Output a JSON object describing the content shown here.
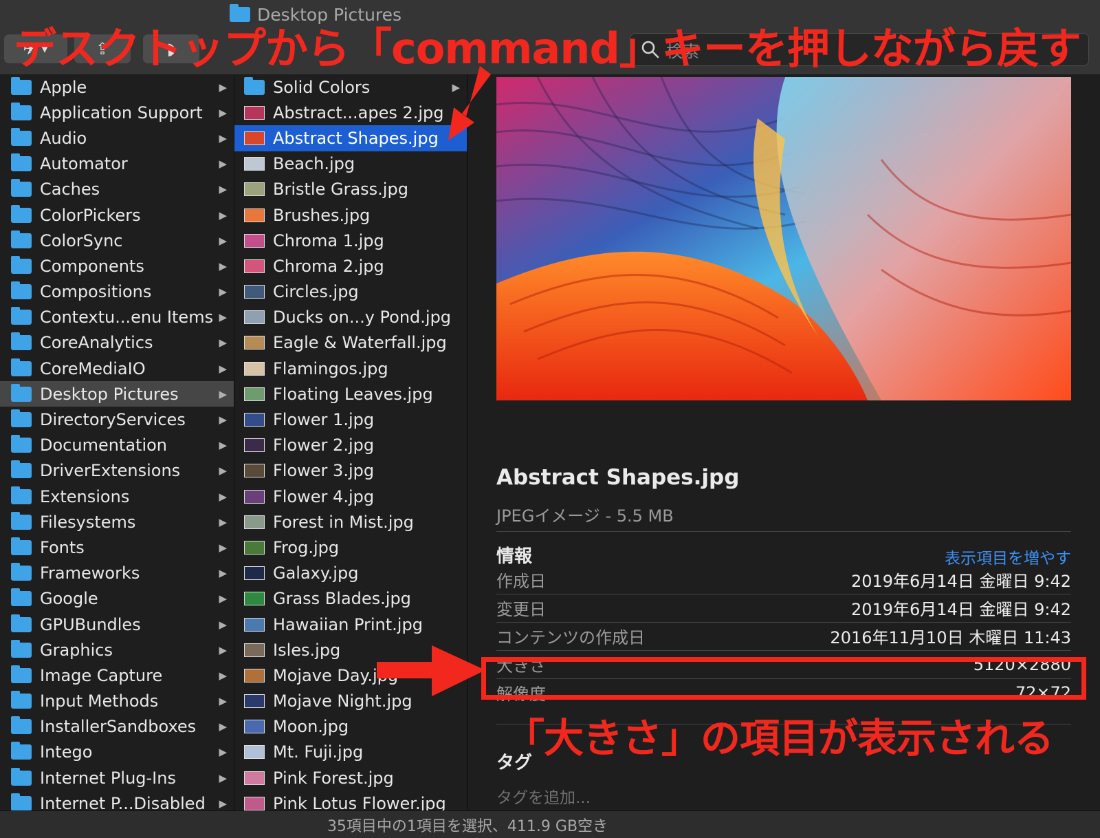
{
  "window": {
    "title": "Desktop Pictures"
  },
  "toolbar": {
    "back_forward_glyph": "✈︎",
    "share_glyph": "⇪",
    "tag_glyph": "◗",
    "search_placeholder": "検索"
  },
  "column1": {
    "items": [
      {
        "label": "Apple"
      },
      {
        "label": "Application Support"
      },
      {
        "label": "Audio"
      },
      {
        "label": "Automator"
      },
      {
        "label": "Caches"
      },
      {
        "label": "ColorPickers"
      },
      {
        "label": "ColorSync"
      },
      {
        "label": "Components"
      },
      {
        "label": "Compositions"
      },
      {
        "label": "Contextu...enu Items"
      },
      {
        "label": "CoreAnalytics"
      },
      {
        "label": "CoreMediaIO"
      },
      {
        "label": "Desktop Pictures"
      },
      {
        "label": "DirectoryServices"
      },
      {
        "label": "Documentation"
      },
      {
        "label": "DriverExtensions"
      },
      {
        "label": "Extensions"
      },
      {
        "label": "Filesystems"
      },
      {
        "label": "Fonts"
      },
      {
        "label": "Frameworks"
      },
      {
        "label": "Google"
      },
      {
        "label": "GPUBundles"
      },
      {
        "label": "Graphics"
      },
      {
        "label": "Image Capture"
      },
      {
        "label": "Input Methods"
      },
      {
        "label": "InstallerSandboxes"
      },
      {
        "label": "Intego"
      },
      {
        "label": "Internet Plug-Ins"
      },
      {
        "label": "Internet P...Disabled"
      }
    ]
  },
  "column2": {
    "items": [
      {
        "label": "Solid Colors"
      },
      {
        "label": "Abstract...apes 2.jpg"
      },
      {
        "label": "Abstract Shapes.jpg"
      },
      {
        "label": "Beach.jpg"
      },
      {
        "label": "Bristle Grass.jpg"
      },
      {
        "label": "Brushes.jpg"
      },
      {
        "label": "Chroma 1.jpg"
      },
      {
        "label": "Chroma 2.jpg"
      },
      {
        "label": "Circles.jpg"
      },
      {
        "label": "Ducks on...y Pond.jpg"
      },
      {
        "label": "Eagle & Waterfall.jpg"
      },
      {
        "label": "Flamingos.jpg"
      },
      {
        "label": "Floating Leaves.jpg"
      },
      {
        "label": "Flower 1.jpg"
      },
      {
        "label": "Flower 2.jpg"
      },
      {
        "label": "Flower 3.jpg"
      },
      {
        "label": "Flower 4.jpg"
      },
      {
        "label": "Forest in Mist.jpg"
      },
      {
        "label": "Frog.jpg"
      },
      {
        "label": "Galaxy.jpg"
      },
      {
        "label": "Grass Blades.jpg"
      },
      {
        "label": "Hawaiian Print.jpg"
      },
      {
        "label": "Isles.jpg"
      },
      {
        "label": "Mojave Day.jpg"
      },
      {
        "label": "Mojave Night.jpg"
      },
      {
        "label": "Moon.jpg"
      },
      {
        "label": "Mt. Fuji.jpg"
      },
      {
        "label": "Pink Forest.jpg"
      },
      {
        "label": "Pink Lotus Flower.jpg"
      }
    ]
  },
  "preview": {
    "file_name": "Abstract Shapes.jpg",
    "file_kind": "JPEGイメージ - 5.5 MB",
    "info_heading": "情報",
    "show_more": "表示項目を増やす",
    "info_rows": [
      {
        "key": "作成日",
        "value": "2019年6月14日 金曜日 9:42"
      },
      {
        "key": "変更日",
        "value": "2019年6月14日 金曜日 9:42"
      },
      {
        "key": "コンテンツの作成日",
        "value": "2016年11月10日 木曜日 11:43"
      },
      {
        "key": "大きさ",
        "value": "5120×2880"
      },
      {
        "key": "解像度",
        "value": "72×72"
      }
    ],
    "tags_heading": "タグ",
    "tags_placeholder": "タグを追加..."
  },
  "status": {
    "text": "35項目中の1項目を選択、411.9 GB空き"
  },
  "annotations": {
    "top": "デスクトップから「command」キーを押しながら戻す",
    "bottom": "「大きさ」の項目が表示される",
    "accent_color": "#f2281f"
  },
  "colors": {
    "selection": "#1d5fd3",
    "path_highlight": "#464646",
    "folder": "#3fa3e8",
    "link": "#3d8ff5"
  }
}
